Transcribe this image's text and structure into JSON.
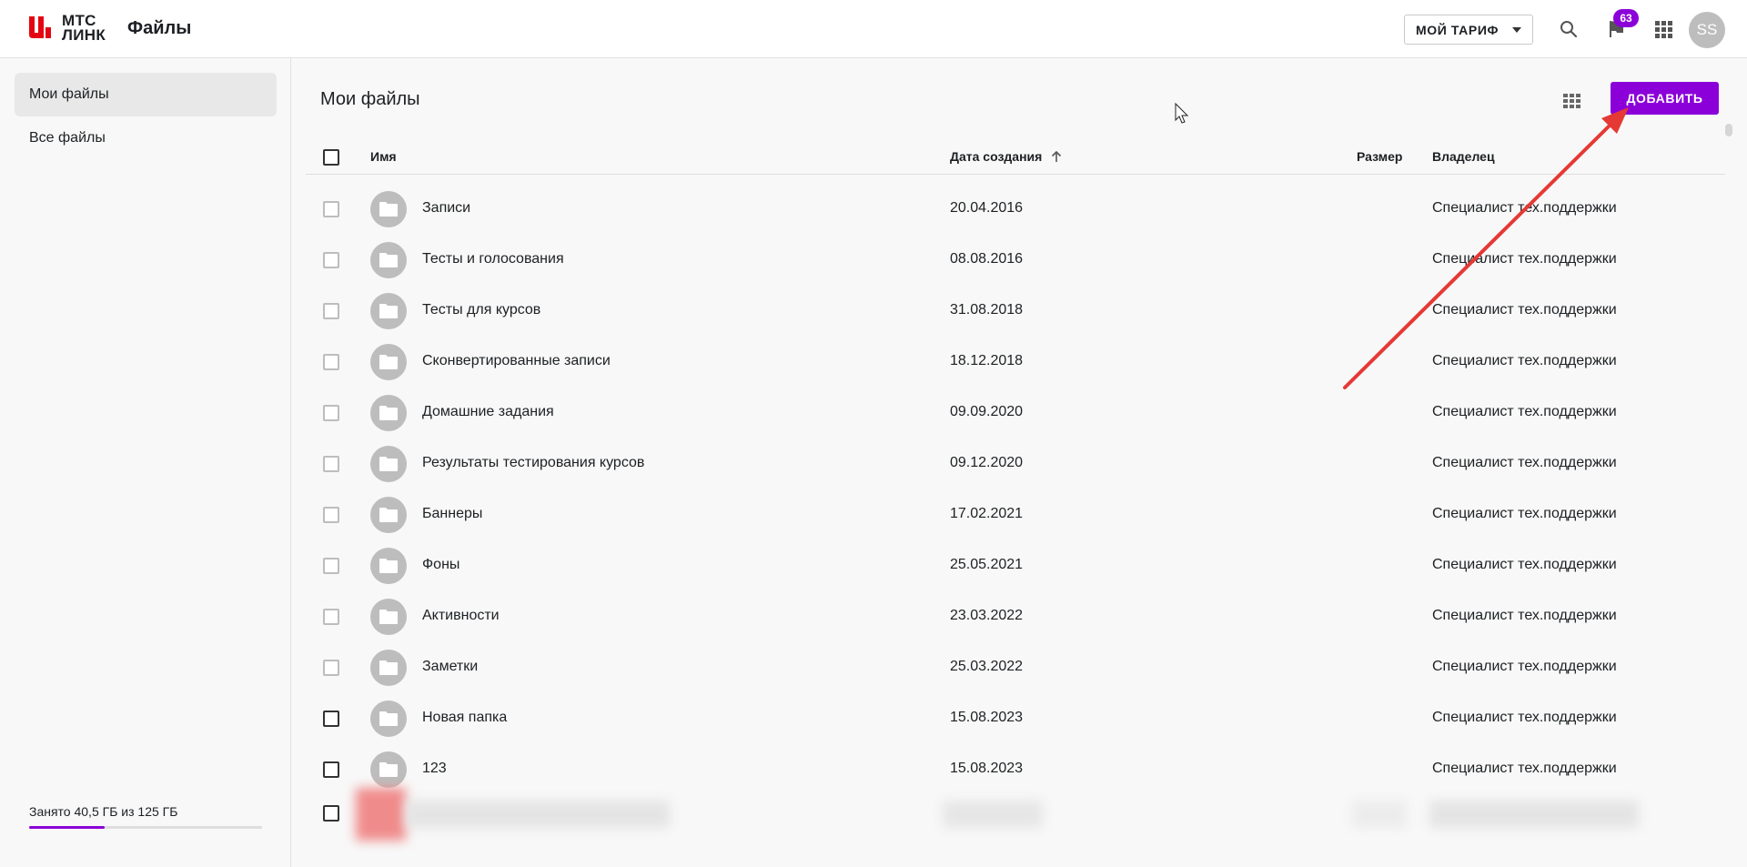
{
  "header": {
    "logo_text_line1": "МТС",
    "logo_text_line2": "ЛИНК",
    "app_title": "Файлы",
    "tariff_label": "МОЙ ТАРИФ",
    "notifications_count": "63",
    "avatar_initials": "SS",
    "icons": [
      "search-icon",
      "flag-icon",
      "apps-grid-icon"
    ]
  },
  "sidebar": {
    "items": [
      {
        "label": "Мои файлы",
        "active": true
      },
      {
        "label": "Все файлы",
        "active": false
      }
    ],
    "storage": {
      "text": "Занято 40,5 ГБ из 125 ГБ",
      "used_gb": 40.5,
      "total_gb": 125
    }
  },
  "main": {
    "title": "Мои файлы",
    "add_button": "ДОБАВИТЬ",
    "table": {
      "columns": {
        "name": "Имя",
        "created": "Дата создания",
        "size": "Размер",
        "owner": "Владелец"
      },
      "sort": {
        "column": "created",
        "direction": "ascending"
      },
      "rows": [
        {
          "name": "Записи",
          "created": "20.04.2016",
          "owner": "Специалист тех.поддержки"
        },
        {
          "name": "Тесты и голосования",
          "created": "08.08.2016",
          "owner": "Специалист тех.поддержки"
        },
        {
          "name": "Тесты для курсов",
          "created": "31.08.2018",
          "owner": "Специалист тех.поддержки"
        },
        {
          "name": "Сконвертированные записи",
          "created": "18.12.2018",
          "owner": "Специалист тех.поддержки"
        },
        {
          "name": "Домашние задания",
          "created": "09.09.2020",
          "owner": "Специалист тех.поддержки"
        },
        {
          "name": "Результаты тестирования курсов",
          "created": "09.12.2020",
          "owner": "Специалист тех.поддержки"
        },
        {
          "name": "Баннеры",
          "created": "17.02.2021",
          "owner": "Специалист тех.поддержки"
        },
        {
          "name": "Фоны",
          "created": "25.05.2021",
          "owner": "Специалист тех.поддержки"
        },
        {
          "name": "Активности",
          "created": "23.03.2022",
          "owner": "Специалист тех.поддержки"
        },
        {
          "name": "Заметки",
          "created": "25.03.2022",
          "owner": "Специалист тех.поддержки"
        },
        {
          "name": "Новая папка",
          "created": "15.08.2023",
          "owner": "Специалист тех.поддержки"
        },
        {
          "name": "123",
          "created": "15.08.2023",
          "owner": "Специалист тех.поддержки"
        }
      ]
    }
  },
  "colors": {
    "accent": "#8b00d9",
    "brand_red": "#e30611",
    "annotation_arrow": "#e53935"
  }
}
